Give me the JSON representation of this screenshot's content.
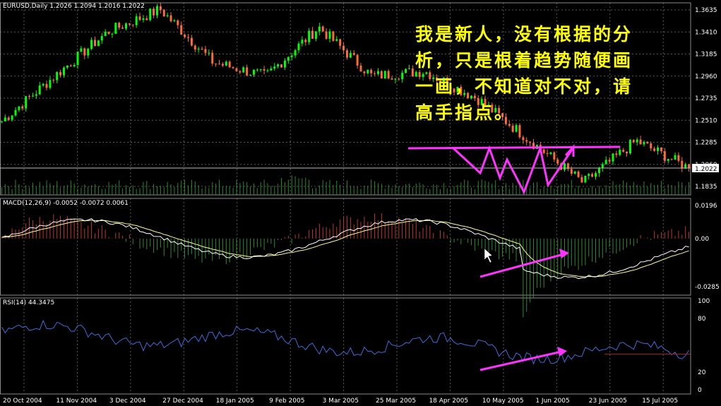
{
  "colors": {
    "background": "#000000",
    "grid": "#5a5a5a",
    "bull_candle": "#00ff00",
    "bear_candle": "#ff6a3a",
    "volume": "#2a8a2a",
    "macd_pos": "#c0362c",
    "macd_neg": "#2f8a2f",
    "macd_signal": "#ffff80",
    "macd_line": "#ffffff",
    "rsi_line": "#3d6de0",
    "rsi_level": "#b02020",
    "annotation": "#ff33ff",
    "note_text": "#ffff00"
  },
  "chart_data": [
    {
      "type": "candlestick",
      "title": "EURUSD,Daily  1.2026 1.2094 1.2016 1.2022",
      "symbol": "EURUSD",
      "timeframe": "Daily",
      "ohlc_last": {
        "open": 1.2026,
        "high": 1.2094,
        "low": 1.2016,
        "close": 1.2022
      },
      "current_price_label": "1.2022",
      "y_ticks": [
        "1.3635",
        "1.3410",
        "1.3185",
        "1.2960",
        "1.2735",
        "1.2510",
        "1.2285",
        "1.2060",
        "1.1835"
      ],
      "ylim": [
        1.1835,
        1.3635
      ],
      "x_tick_labels": [
        "20 Oct 2004",
        "11 Nov 2004",
        "3 Dec 2004",
        "27 Dec 2004",
        "18 Jan 2005",
        "9 Feb 2005",
        "3 Mar 2005",
        "25 Mar 2005",
        "18 Apr 2005",
        "10 May 2005",
        "1 Jun 2005",
        "23 Jun 2005",
        "15 Jul 2005"
      ],
      "closes_approx": [
        1.25,
        1.296,
        1.341,
        1.364,
        1.31,
        1.296,
        1.346,
        1.296,
        1.301,
        1.273,
        1.23,
        1.187,
        1.23,
        1.2022
      ],
      "annotation_pattern": "triple-bottom / neckline"
    },
    {
      "type": "histogram+line",
      "title": "MACD(12,26,9) -0.0052 -0.0072 0.0061",
      "params": "12,26,9",
      "values": [
        -0.0052,
        -0.0072,
        0.0061
      ],
      "y_ticks": [
        "0.0196",
        "0.00",
        "-0.0285"
      ],
      "ylim": [
        -0.0285,
        0.0196
      ]
    },
    {
      "type": "line",
      "title": "RSI(14) 44.3475",
      "period": 14,
      "value": 44.3475,
      "y_ticks": [
        "100",
        "80",
        "20",
        "0"
      ],
      "ylim": [
        0,
        100
      ],
      "level": 40
    }
  ],
  "note": {
    "lines": [
      "我是新人，没有根据的分",
      "析，只是根着趋势随便画",
      "一画，不知道对不对，请",
      "高手指点。"
    ]
  }
}
